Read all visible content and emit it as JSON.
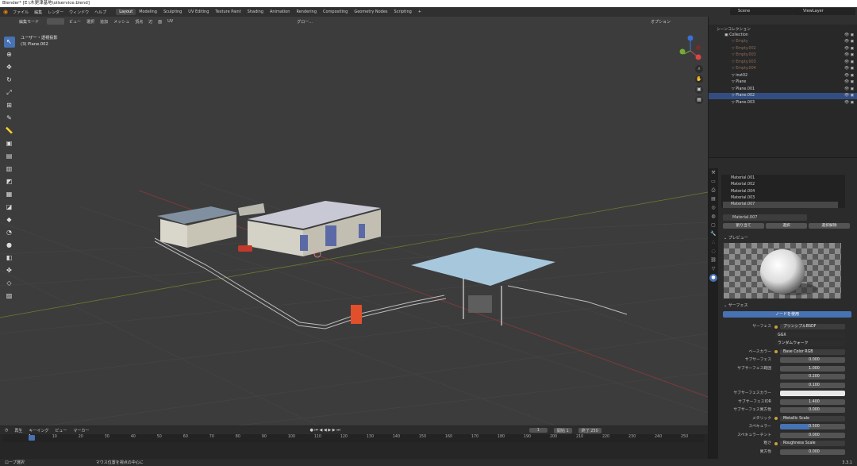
{
  "window_title": "Blender* [E:\\木更津基地\\oilservice.blend]",
  "top_menu": [
    "ファイル",
    "編集",
    "レンダー",
    "ウィンドウ",
    "ヘルプ"
  ],
  "workspaces": [
    "Layout",
    "Modeling",
    "Sculpting",
    "UV Editing",
    "Texture Paint",
    "Shading",
    "Animation",
    "Rendering",
    "Compositing",
    "Geometry Nodes",
    "Scripting",
    "+"
  ],
  "scene_name": "Scene",
  "view_layer": "ViewLayer",
  "viewport": {
    "mode": "編集モード",
    "menus": [
      "ビュー",
      "選択",
      "追加",
      "メッシュ",
      "頂点",
      "辺",
      "面",
      "UV"
    ],
    "transform_orientation": "グロー...",
    "options_label": "オプション",
    "info_line1": "ユーザー・透視投影",
    "info_line2": "(3) Plane.002"
  },
  "outliner": {
    "title": "シーンコレクション",
    "rows": [
      {
        "label": "Collection",
        "selected": false,
        "dim": false
      },
      {
        "label": "Empty",
        "selected": false,
        "dim": true
      },
      {
        "label": "Empty.002",
        "selected": false,
        "dim": true
      },
      {
        "label": "Empty.003",
        "selected": false,
        "dim": true
      },
      {
        "label": "Empty.003",
        "selected": false,
        "dim": true
      },
      {
        "label": "Empty.004",
        "selected": false,
        "dim": true
      },
      {
        "label": "inst02",
        "selected": false,
        "dim": false
      },
      {
        "label": "Plane",
        "selected": false,
        "dim": false
      },
      {
        "label": "Plane.001",
        "selected": false,
        "dim": false
      },
      {
        "label": "Plane.002",
        "selected": true,
        "dim": false
      },
      {
        "label": "Plane.003",
        "selected": false,
        "dim": false
      }
    ]
  },
  "materials": {
    "slots": [
      "Material.001",
      "Material.002",
      "Material.004",
      "Material.003",
      "Material.007"
    ],
    "active": "Material.007",
    "buttons": [
      "割り当て",
      "選択",
      "選択解除"
    ],
    "preview_label": "プレビュー",
    "surface_header": "サーフェス",
    "use_nodes_label": "ノードを使用",
    "fields": [
      {
        "label": "サーフェス",
        "value": "プリンシプルBSDF",
        "kind": "link"
      },
      {
        "label": "",
        "value": "GGX",
        "kind": "drop"
      },
      {
        "label": "",
        "value": "ランダムウォーク",
        "kind": "drop"
      },
      {
        "label": "ベースカラー",
        "value": "Base Color RGB",
        "kind": "link"
      },
      {
        "label": "サブサーフェス",
        "value": "0.000",
        "kind": "num"
      },
      {
        "label": "サブサーフェス範囲",
        "value": "1.000",
        "kind": "num"
      },
      {
        "label": "",
        "value": "0.200",
        "kind": "num"
      },
      {
        "label": "",
        "value": "0.100",
        "kind": "num"
      },
      {
        "label": "サブサーフェスカラー",
        "value": "",
        "kind": "color"
      },
      {
        "label": "サブサーフェスIOR",
        "value": "1.400",
        "kind": "num"
      },
      {
        "label": "サブサーフェス異方性",
        "value": "0.000",
        "kind": "num"
      },
      {
        "label": "メタリック",
        "value": "Metallic Scale",
        "kind": "link"
      },
      {
        "label": "スペキュラー",
        "value": "0.500",
        "kind": "blue"
      },
      {
        "label": "スペキュラーチント",
        "value": "0.000",
        "kind": "num"
      },
      {
        "label": "粗さ",
        "value": "Roughness Scale",
        "kind": "link"
      },
      {
        "label": "異方性",
        "value": "0.000",
        "kind": "num"
      }
    ]
  },
  "timeline": {
    "menus": [
      "再生",
      "キーイング",
      "ビュー",
      "マーカー"
    ],
    "current_frame": "1",
    "start_label": "開始",
    "start_value": "1",
    "end_label": "終了",
    "end_value": "250",
    "ticks": [
      "1",
      "10",
      "20",
      "30",
      "40",
      "50",
      "60",
      "70",
      "80",
      "90",
      "100",
      "110",
      "120",
      "130",
      "140",
      "150",
      "160",
      "170",
      "180",
      "190",
      "200",
      "210",
      "220",
      "230",
      "240",
      "250"
    ]
  },
  "status": {
    "left": "ロープ選択",
    "middle": "マウス位置を視点の中心に",
    "version": "3.3.1"
  },
  "colors": {
    "accent": "#4772b3",
    "selected_row": "#334d80",
    "header": "#303030"
  }
}
